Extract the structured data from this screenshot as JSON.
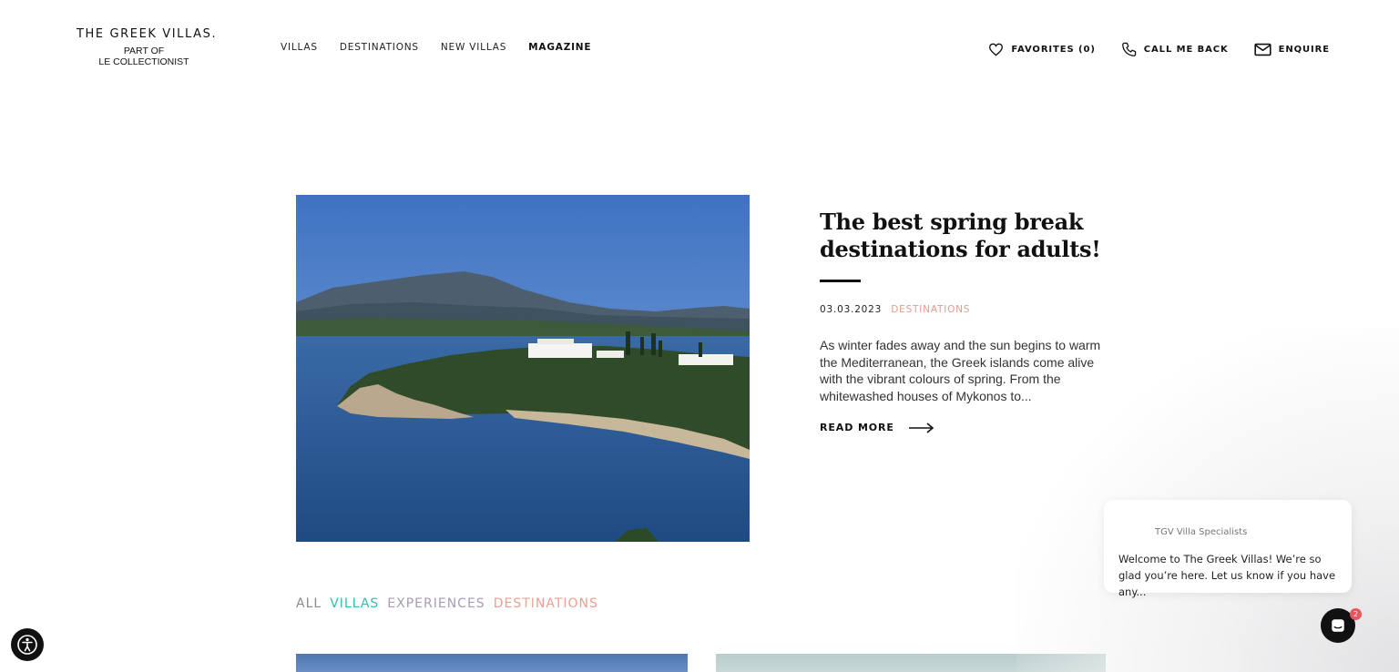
{
  "header": {
    "logo_title": "THE GREEK VILLAS.",
    "logo_sub_1": "PART OF",
    "logo_sub_2": "LE COLLECTIONIST",
    "nav": [
      {
        "label": "VILLAS"
      },
      {
        "label": "DESTINATIONS"
      },
      {
        "label": "NEW VILLAS"
      },
      {
        "label": "MAGAZINE",
        "active": true
      }
    ],
    "favorites_label": "FAVORITES (0)",
    "callback_label": "CALL ME BACK",
    "enquire_label": "ENQUIRE"
  },
  "featured": {
    "title": "The best spring break destinations for adults!",
    "date": "03.03.2023",
    "category": "DESTINATIONS",
    "excerpt": "As winter fades away and the sun begins to warm the Mediterranean, the Greek islands come alive with the vibrant colours of spring. From the whitewashed houses of Mykonos to...",
    "read_more": "READ MORE"
  },
  "filters": [
    {
      "label": "ALL",
      "color": "#8a8a8a"
    },
    {
      "label": "VILLAS",
      "color": "#2fbfae"
    },
    {
      "label": "EXPERIENCES",
      "color": "#a99ab6"
    },
    {
      "label": "DESTINATIONS",
      "color": "#e9a194"
    }
  ],
  "chat": {
    "sender": "TGV Villa Specialists",
    "message": "Welcome to The Greek Villas! We’re so glad you’re here. Let us know if you have any...",
    "badge_count": "2"
  },
  "colors": {
    "accent_destinations": "#e29b8d",
    "accent_villas": "#2fbfae",
    "text_dark": "#111111"
  }
}
